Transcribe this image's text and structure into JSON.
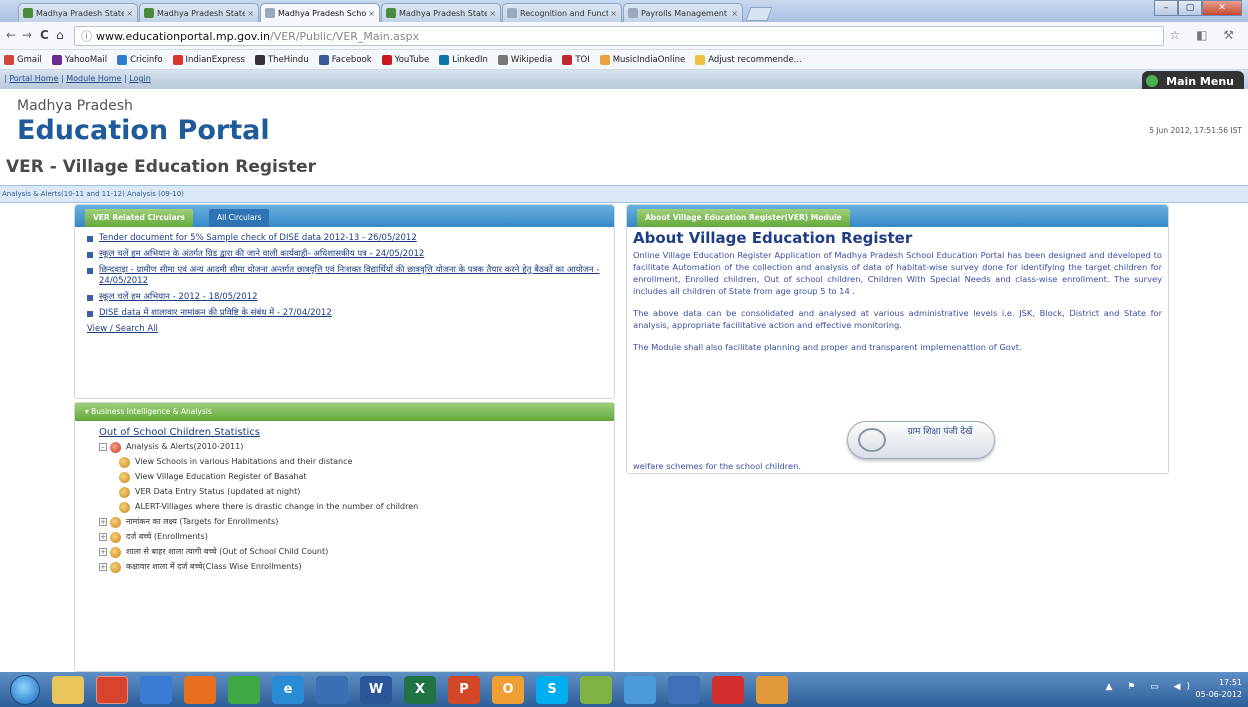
{
  "browser": {
    "tabs": [
      {
        "label": "Madhya Pradesh State Sch",
        "color": "#4a8c3a",
        "active": false
      },
      {
        "label": "Madhya Pradesh State Sch",
        "color": "#4a8c3a",
        "active": false
      },
      {
        "label": "Madhya Pradesh School Ed",
        "color": "#9aa9bd",
        "active": true
      },
      {
        "label": "Madhya Pradesh State Sch",
        "color": "#4a8c3a",
        "active": false
      },
      {
        "label": "Recognition and Function",
        "color": "#9aa9bd",
        "active": false
      },
      {
        "label": "Payrolls Management",
        "color": "#9aa9bd",
        "active": false
      }
    ],
    "url_host": "www.educationportal.mp.gov.in",
    "url_path": "/VER/Public/VER_Main.aspx",
    "bookmarks": [
      {
        "label": "Gmail",
        "color": "#d44638"
      },
      {
        "label": "YahooMail",
        "color": "#6b2c91"
      },
      {
        "label": "Cricinfo",
        "color": "#2f7bd1"
      },
      {
        "label": "IndianExpress",
        "color": "#d9362b"
      },
      {
        "label": "TheHindu",
        "color": "#333333"
      },
      {
        "label": "Facebook",
        "color": "#3b5998"
      },
      {
        "label": "YouTube",
        "color": "#cc181e"
      },
      {
        "label": "LinkedIn",
        "color": "#0e76a8"
      },
      {
        "label": "Wikipedia",
        "color": "#777777"
      },
      {
        "label": "TOI",
        "color": "#c1272d"
      },
      {
        "label": "MusicIndiaOnline",
        "color": "#e8a33a"
      },
      {
        "label": "Adjust recommende...",
        "color": "#f0c040"
      }
    ]
  },
  "topbar": {
    "links": [
      "Portal Home",
      "Module Home",
      "Login"
    ],
    "main_menu": "Main Menu"
  },
  "header": {
    "state": "Madhya Pradesh",
    "portal": "Education Portal",
    "register": "VER - Village Education Register",
    "datetime": "5 Jun 2012, 17:51:56 IST"
  },
  "subnav": {
    "text": "Analysis & Alerts(10-11 and 11-12) Analysis (09-10)"
  },
  "circulars": {
    "tab_active": "VER Related Circulars",
    "tab_other": "All Circulars",
    "items": [
      "Tender document for 5% Sample check of DISE data 2012-13 - 26/05/2012",
      "स्कूल चलें हम अभियान के अंतर्गत ग्रिड द्वारा की जाने वाली कार्यवाही- अधिशासकीय पत्र - 24/05/2012",
      "छिन्दवाड़ा - ग्रामीण सीमा एवं अन्य आदमी सीमा योजना अन्तर्गत छात्रवृत्ति एवं निःशक्त विद्यार्थियों की छात्रवृत्ति योजना के पत्रक तैयार करने हेतु बैठकों का आयोजन - 24/05/2012",
      "स्कूल चलें हम अभियान - 2012 - 18/05/2012",
      "DISE data में शालावार नामांकन की प्रविष्टि के संबंध में - 27/04/2012"
    ],
    "view_all": "View / Search All"
  },
  "bi": {
    "header": "Business Intelligence & Analysis",
    "ooc_link": "Out of School Children Statistics",
    "root": "Analysis & Alerts(2010-2011)",
    "children": [
      "View Schools in various Habitations and their distance",
      "View Village Education Register of Basahat",
      "VER Data Entry Status (updated at night)",
      "ALERT-Villages where there is drastic change in the number of children"
    ],
    "siblings": [
      "नामांकन का लक्ष्य (Targets for Enrollments)",
      "दर्ज बच्चे (Enrollments)",
      "शाला से बाहर शाला त्यागी बच्चे (Out of School Child Count)",
      "कक्षावार शाला में दर्ज बच्चे(Class Wise Enrollments)"
    ]
  },
  "about": {
    "tab": "About Village Education Register(VER) Module",
    "title": "About Village Education Register",
    "p1": "Online Village Education Register Application of Madhya Pradesh School Education Portal has been designed and developed to facilitate Automation of the collection and analysis of data of habitat-wise survey done for identifying the target children for enrollment, Enrolled children, Out of school children, Children With Special Needs and class-wise enrollment. The survey includes all children of State from age group 5 to 14 .",
    "p2": "The above data can be consolidated and analysed at various administrative levels i.e. JSK, Block, District and State for analysis, appropriate facilitative action and effective monitoring.",
    "p3": "The Module shall also facilitate planning and proper and transparent implemenattion of Govt.",
    "welfare": "welfare schemes for the school children.",
    "button_text": "ग्राम शिक्षा पंजी देखें"
  },
  "taskbar": {
    "icons": [
      {
        "name": "explorer-icon",
        "color": "#e9c45a",
        "label": ""
      },
      {
        "name": "chrome-icon",
        "color": "#d9442f",
        "label": ""
      },
      {
        "name": "chromium-icon",
        "color": "#3a7bd5",
        "label": ""
      },
      {
        "name": "firefox-icon",
        "color": "#e76f1e",
        "label": ""
      },
      {
        "name": "ie9-icon",
        "color": "#3fa843",
        "label": ""
      },
      {
        "name": "ie-icon",
        "color": "#2a8bd6",
        "label": "e"
      },
      {
        "name": "media-icon",
        "color": "#3b6fb4",
        "label": ""
      },
      {
        "name": "word-icon",
        "color": "#2b579a",
        "label": "W"
      },
      {
        "name": "excel-icon",
        "color": "#217346",
        "label": "X"
      },
      {
        "name": "powerpoint-icon",
        "color": "#d24726",
        "label": "P"
      },
      {
        "name": "outlook-icon",
        "color": "#f0a030",
        "label": "O"
      },
      {
        "name": "skype-icon",
        "color": "#00aff0",
        "label": "S"
      },
      {
        "name": "gtalk-icon",
        "color": "#7cb342",
        "label": ""
      },
      {
        "name": "ie-pinned-icon",
        "color": "#4a9bd8",
        "label": ""
      },
      {
        "name": "media-player-icon",
        "color": "#3e6fb7",
        "label": ""
      },
      {
        "name": "acrobat-icon",
        "color": "#d32f2f",
        "label": ""
      },
      {
        "name": "installer-icon",
        "color": "#e09a3a",
        "label": ""
      }
    ],
    "time": "17:51",
    "date": "05-06-2012"
  }
}
